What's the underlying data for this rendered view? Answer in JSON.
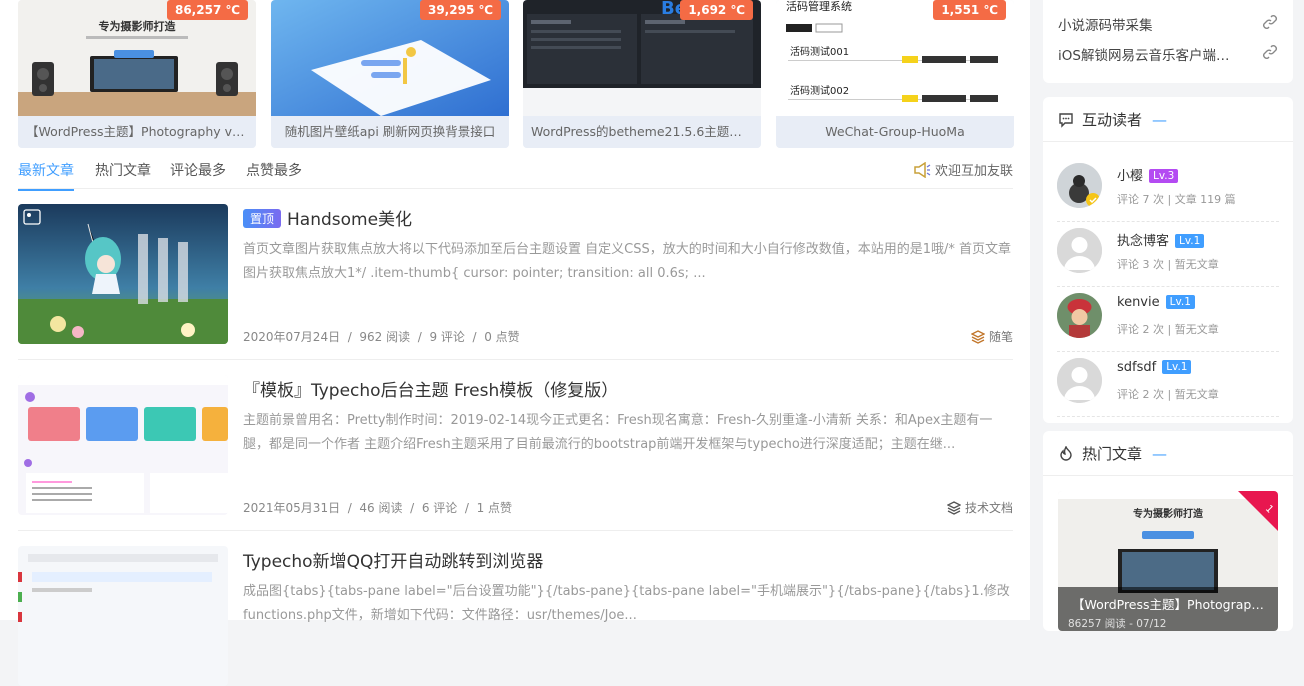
{
  "top_cards": [
    {
      "temp": "86,257 ℃",
      "title": "【WordPress主题】Photography v6.…",
      "thumb_text": "专为摄影师打造"
    },
    {
      "temp": "39,295 ℃",
      "title": "随机图片壁纸api 刷新网页换背景接口"
    },
    {
      "temp": "1,692 ℃",
      "title": "WordPress的betheme21.5.6主题，自…",
      "thumb_text": "Be"
    },
    {
      "temp": "1,551 ℃",
      "title": "WeChat-Group-HuoMa",
      "thumb_text": "活码管理系统",
      "row1": "活码测试001",
      "row2": "活码测试002"
    }
  ],
  "tabs": [
    "最新文章",
    "热门文章",
    "评论最多",
    "点赞最多"
  ],
  "friend_link": "欢迎互加友联",
  "articles": [
    {
      "pin": "置顶",
      "title": "Handsome美化",
      "desc": "首页文章图片获取焦点放大将以下代码添加至后台主题设置 自定义CSS，放大的时间和大小自行修改数值，本站用的是1哦/* 首页文章图片获取焦点放大1*/ .item-thumb{ cursor: pointer; transition: all 0.6s; ...",
      "date": "2020年07月24日",
      "views": "962 阅读",
      "comments": "9 评论",
      "likes": "0 点赞",
      "category": "随笔"
    },
    {
      "title": "『模板』Typecho后台主题 Fresh模板（修复版）",
      "desc": "主题前景曾用名：Pretty制作时间：2019-02-14现今正式更名：Fresh现名寓意：Fresh-久别重逢-小清新 关系：和Apex主题有一腿，都是同一个作者 主题介绍Fresh主题采用了目前最流行的bootstrap前端开发框架与typecho进行深度适配；主题在继...",
      "date": "2021年05月31日",
      "views": "46 阅读",
      "comments": "6 评论",
      "likes": "1 点赞",
      "category": "技术文档"
    },
    {
      "title": "Typecho新增QQ打开自动跳转到浏览器",
      "desc": "成品图{tabs}{tabs-pane label=\"后台设置功能\"}{/tabs-pane}{tabs-pane label=\"手机端展示\"}{/tabs-pane}{/tabs}1.修改functions.php文件，新增如下代码：文件路径：usr/themes/Joe..."
    }
  ],
  "links": [
    "小说源码带采集",
    "iOS解锁网易云音乐客户端…"
  ],
  "readers_title": "互动读者",
  "readers": [
    {
      "name": "小樱",
      "level": "Lv.3",
      "level_color": "#b44bf2",
      "stat": "评论 7 次 |  文章 119 篇"
    },
    {
      "name": "执念博客",
      "level": "Lv.1",
      "level_color": "#409eff",
      "stat": "评论 3 次 |  暂无文章"
    },
    {
      "name": "kenvie",
      "level": "Lv.1",
      "level_color": "#409eff",
      "stat": "评论 2 次 |  暂无文章"
    },
    {
      "name": "sdfsdf",
      "level": "Lv.1",
      "level_color": "#409eff",
      "stat": "评论 2 次 |  暂无文章"
    }
  ],
  "hot_title": "热门文章",
  "hot": {
    "rank": "1",
    "title": "【WordPress主题】Photograp…",
    "meta": "86257 阅读 - 07/12",
    "thumb_text": "专为摄影师打造"
  },
  "colors": {
    "accent": "#409eff",
    "temp": "#f46b45"
  }
}
